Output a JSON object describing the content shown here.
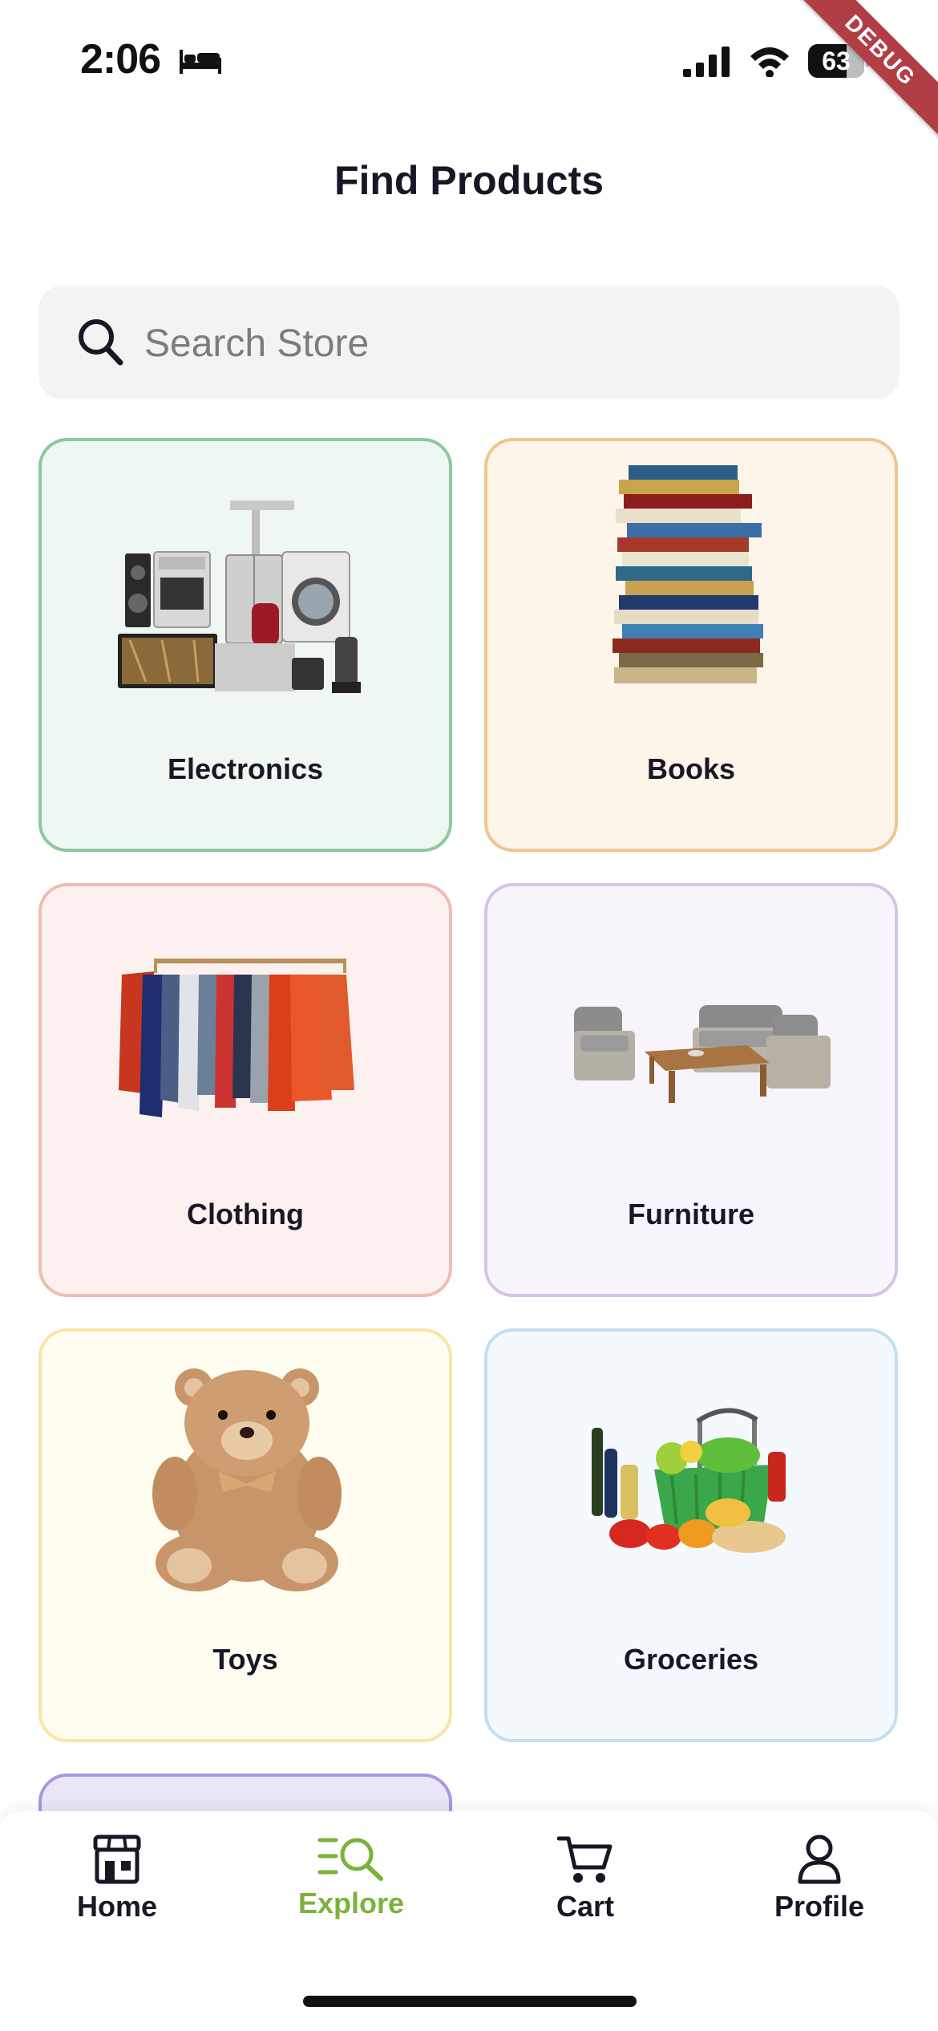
{
  "status_bar": {
    "time": "2:06",
    "battery_level": "63",
    "icons": [
      "bed-icon",
      "signal-icon",
      "wifi-icon",
      "battery-icon"
    ]
  },
  "debug_banner": "DEBUG",
  "header": {
    "title": "Find Products"
  },
  "search": {
    "placeholder": "Search Store",
    "value": "",
    "icon": "search-icon"
  },
  "categories": [
    {
      "label": "Electronics",
      "image": "electronics-image",
      "bg": "#eef7f1",
      "border": "#8fc89c"
    },
    {
      "label": "Books",
      "image": "books-image",
      "bg": "#fdf4ea",
      "border": "#f0c58d"
    },
    {
      "label": "Clothing",
      "image": "clothing-image",
      "bg": "#fdf1ef",
      "border": "#eebcb3"
    },
    {
      "label": "Furniture",
      "image": "furniture-image",
      "bg": "#f8f4fc",
      "border": "#d7c3e6"
    },
    {
      "label": "Toys",
      "image": "toys-image",
      "bg": "#fffcf0",
      "border": "#f7e6a5"
    },
    {
      "label": "Groceries",
      "image": "groceries-image",
      "bg": "#f4f9fd",
      "border": "#c3dff0"
    }
  ],
  "bottom_nav": {
    "active_color": "#7bb23b",
    "items": [
      {
        "label": "Home",
        "icon": "store-icon"
      },
      {
        "label": "Explore",
        "icon": "explore-icon",
        "active": true
      },
      {
        "label": "Cart",
        "icon": "cart-icon"
      },
      {
        "label": "Profile",
        "icon": "profile-icon"
      }
    ]
  }
}
